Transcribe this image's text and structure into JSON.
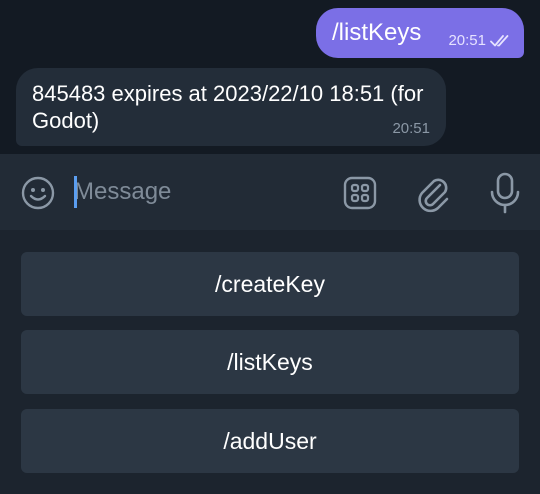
{
  "messages": {
    "outgoing": {
      "text": "/listKeys",
      "time": "20:51",
      "status_icon": "double-check-icon"
    },
    "incoming": {
      "text": "845483 expires at 2023/22/10 18:51 (for Godot)",
      "time": "20:51"
    }
  },
  "composer": {
    "placeholder": "Message",
    "value": "",
    "icons": [
      "emoji-icon",
      "bot-keyboard-icon",
      "attach-icon",
      "microphone-icon"
    ]
  },
  "keyboard": {
    "buttons": [
      "/createKey",
      "/listKeys",
      "/addUser"
    ]
  },
  "colors": {
    "outgoing_bubble": "#7b6fe6",
    "incoming_bubble": "#232d39",
    "keyboard_button": "#2c3744",
    "caret": "#5b9ef0"
  }
}
